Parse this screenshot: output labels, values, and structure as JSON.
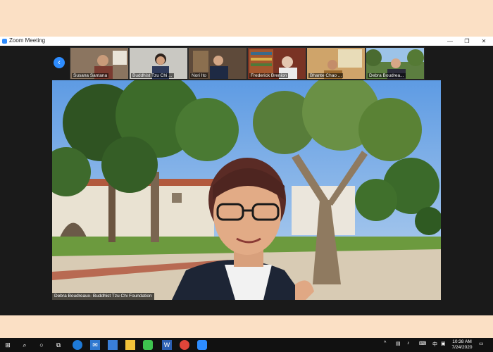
{
  "window": {
    "title": "Zoom Meeting"
  },
  "controls": {
    "minimize": "—",
    "maximize": "❐",
    "close": "✕"
  },
  "participants": [
    {
      "name": "Susana Santana"
    },
    {
      "name": "Buddhist Tzu Chi ..."
    },
    {
      "name": "Nori Ito"
    },
    {
      "name": "Frederick Brenion"
    },
    {
      "name": "Bhante Chao ..."
    },
    {
      "name": "Debra Boudrea..."
    }
  ],
  "active_speaker": {
    "label": "Debra Boudreaux- Buddhist Tzu Chi Foundation"
  },
  "taskbar": {
    "time": "10:38 AM",
    "date": "7/24/2020",
    "lang": "中"
  },
  "colors": {
    "zoom_blue": "#2d8cff",
    "taskbar": "#111111"
  }
}
